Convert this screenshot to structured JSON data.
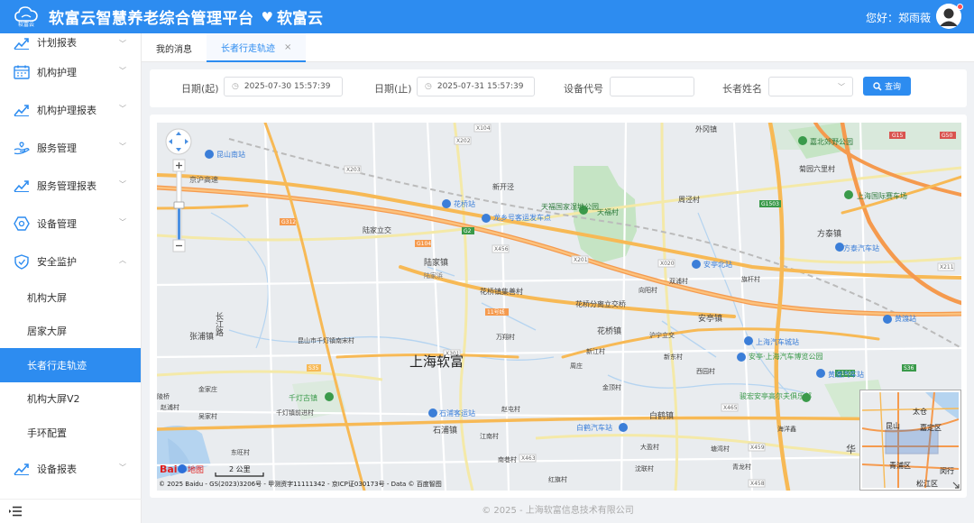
{
  "header": {
    "logo_text": "软富云",
    "title": "软富云智慧养老综合管理平台",
    "brand": "软富云",
    "greeting": "您好：郑雨薇",
    "icons": [
      "cloud-icon",
      "heart-icon",
      "user-avatar-icon"
    ]
  },
  "sidebar": {
    "items": [
      {
        "label": "计划报表",
        "icon": "chart-up-icon"
      },
      {
        "label": "机构护理",
        "icon": "calendar-icon"
      },
      {
        "label": "机构护理报表",
        "icon": "chart-up-icon"
      },
      {
        "label": "服务管理",
        "icon": "hand-heart-icon"
      },
      {
        "label": "服务管理报表",
        "icon": "chart-up-icon"
      },
      {
        "label": "设备管理",
        "icon": "hexagon-icon"
      },
      {
        "label": "安全监护",
        "icon": "shield-icon"
      }
    ],
    "sub_items": [
      {
        "label": "机构大屏",
        "active": false
      },
      {
        "label": "居家大屏",
        "active": false
      },
      {
        "label": "长者行走轨迹",
        "active": true
      },
      {
        "label": "机构大屏V2",
        "active": false
      },
      {
        "label": "手环配置",
        "active": false
      }
    ],
    "last_item": {
      "label": "设备报表",
      "icon": "chart-up-icon"
    },
    "collapse_icon": "menu-collapse-icon"
  },
  "tabs": [
    {
      "label": "我的消息",
      "active": false
    },
    {
      "label": "长者行走轨迹",
      "active": true,
      "close": "×"
    }
  ],
  "filter": {
    "start_label": "日期(起)",
    "start_value": "2025-07-30 15:57:39",
    "end_label": "日期(止)",
    "end_value": "2025-07-31 15:57:39",
    "device_label": "设备代号",
    "device_value": "",
    "name_label": "长者姓名",
    "name_value": "",
    "query_label": "查询"
  },
  "map": {
    "center_label": "上海软富",
    "scale": "2 公里",
    "copyright": "© 2025 Baidu - GS(2023)3206号 - 甲测资字11111342 - 京ICP证030173号 - Data © 百度智图",
    "baidu": "Bai",
    "baidu2": "地图",
    "places": [
      {
        "t": "外冈镇"
      },
      {
        "t": "嘉北郊野公园"
      },
      {
        "t": "菊园六里村"
      },
      {
        "t": "上海国际赛车场"
      },
      {
        "t": "昆山南站"
      },
      {
        "t": "京沪高速"
      },
      {
        "t": "新开泾"
      },
      {
        "t": "天福国家湿地公园"
      },
      {
        "t": "天福村"
      },
      {
        "t": "周泾村"
      },
      {
        "t": "花桥站"
      },
      {
        "t": "龙乡号客运发车点"
      },
      {
        "t": "陆家立交"
      },
      {
        "t": "陆家镇"
      },
      {
        "t": "陆家浜"
      },
      {
        "t": "方泰镇"
      },
      {
        "t": "方泰汽车站"
      },
      {
        "t": "安亭北站"
      },
      {
        "t": "花桥镇集善村"
      },
      {
        "t": "花桥分离立交桥"
      },
      {
        "t": "向阳村"
      },
      {
        "t": "双浦村"
      },
      {
        "t": "旗杆村"
      },
      {
        "t": "安亭镇"
      },
      {
        "t": "黄渡站"
      },
      {
        "t": "张浦镇"
      },
      {
        "t": "长江路"
      },
      {
        "t": "昆山市千灯镇南宋村"
      },
      {
        "t": "万翔村"
      },
      {
        "t": "花桥镇"
      },
      {
        "t": "沪宁立交"
      },
      {
        "t": "新江村"
      },
      {
        "t": "上海汽车城站"
      },
      {
        "t": "新东村"
      },
      {
        "t": "安亭·上海汽车博览公园"
      },
      {
        "t": "西园村"
      },
      {
        "t": "黄渡汽车站"
      },
      {
        "t": "周庄"
      },
      {
        "t": "金家庄"
      },
      {
        "t": "金顶村"
      },
      {
        "t": "骏宏安亭高尔夫俱乐部"
      },
      {
        "t": "陵桥"
      },
      {
        "t": "赵浦村"
      },
      {
        "t": "千灯古镇"
      },
      {
        "t": "千灯镇前进村"
      },
      {
        "t": "吴家村"
      },
      {
        "t": "石浦客运站"
      },
      {
        "t": "赵屯村"
      },
      {
        "t": "白鹤镇"
      },
      {
        "t": "石浦镇"
      },
      {
        "t": "白鹤汽车站"
      },
      {
        "t": "海洋鑫"
      },
      {
        "t": "江南村"
      },
      {
        "t": "大盈村"
      },
      {
        "t": "东旺村"
      },
      {
        "t": "塘湾村"
      },
      {
        "t": "南巷村"
      },
      {
        "t": "沈联村"
      },
      {
        "t": "青龙村"
      },
      {
        "t": "华"
      },
      {
        "t": "红旗村"
      },
      {
        "t": "太仓"
      },
      {
        "t": "嘉定区"
      },
      {
        "t": "昆山"
      },
      {
        "t": "青浦区"
      },
      {
        "t": "闵行"
      },
      {
        "t": "松江区"
      }
    ],
    "roads": [
      "X104",
      "X202",
      "X203",
      "G312",
      "G15",
      "G1503",
      "G2",
      "X201",
      "X020",
      "X211",
      "X301",
      "X465",
      "X463",
      "X459",
      "X458",
      "G1501",
      "G50",
      "11号线",
      "S35",
      "S36",
      "X456",
      "G104",
      "11号线"
    ]
  },
  "footer": "© 2025 - 上海软富信息技术有限公司",
  "colors": {
    "primary": "#2d8cf0",
    "highway": "#f7b955",
    "highway_orange": "#f59a4e",
    "water": "#b5d4f0",
    "green": "#c5e4c4"
  }
}
